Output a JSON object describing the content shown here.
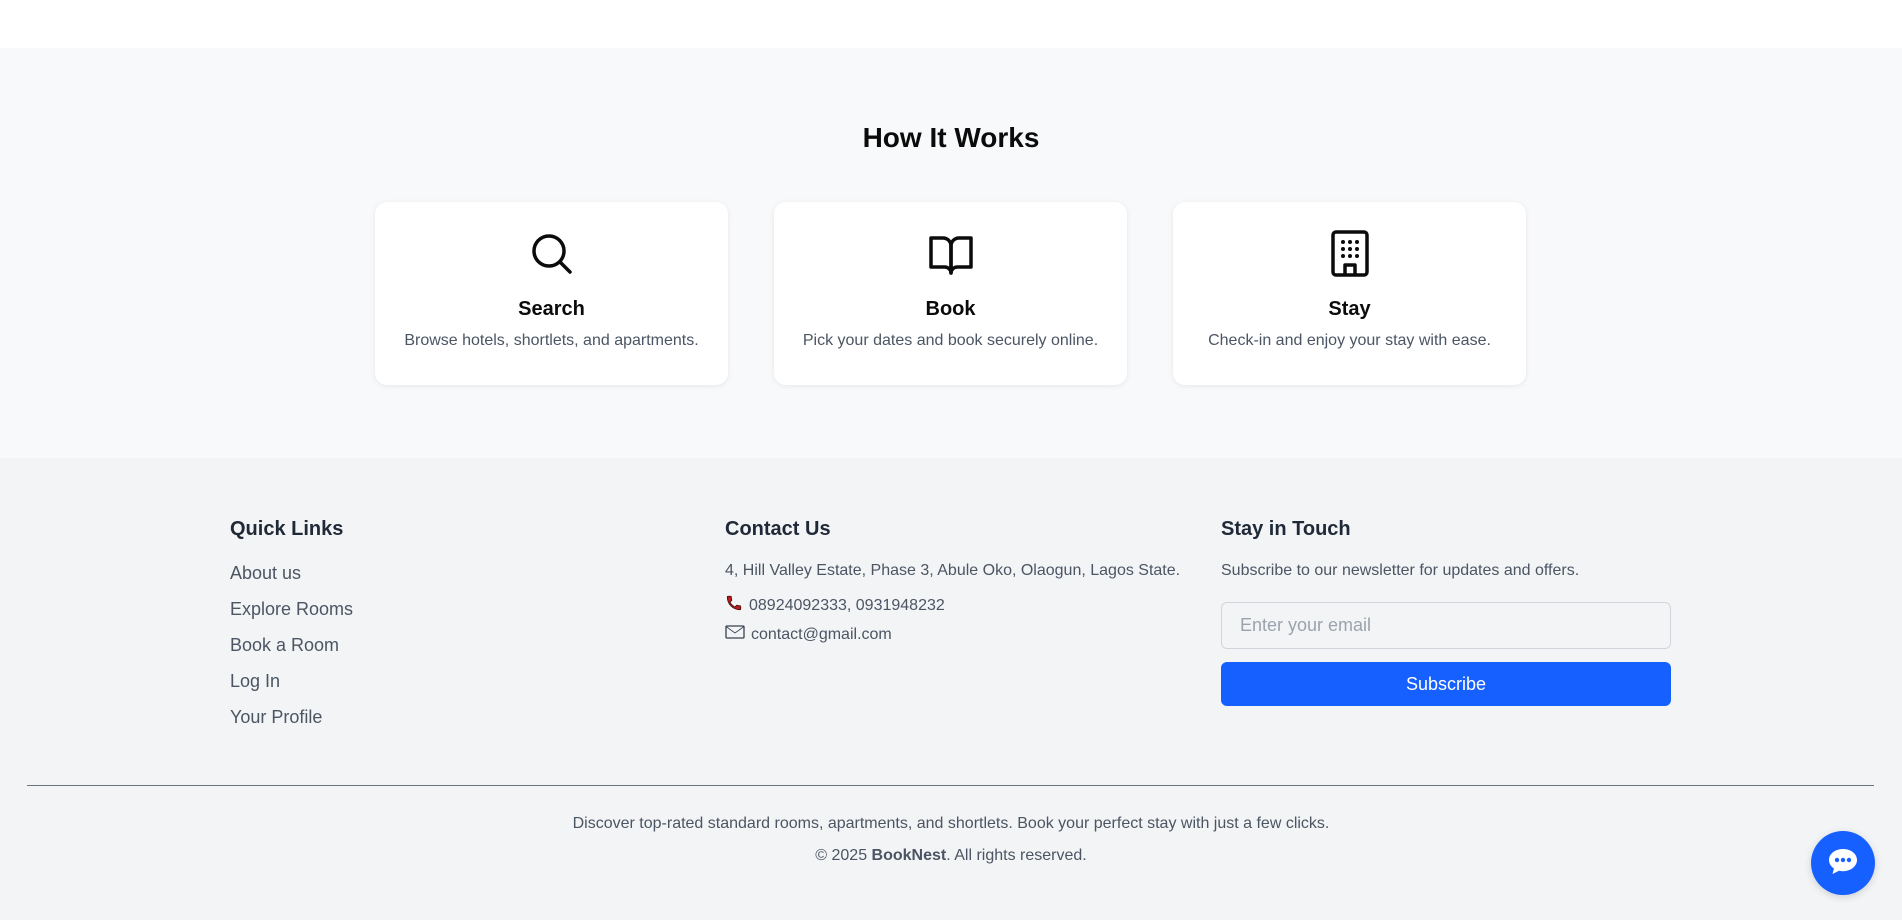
{
  "how_it_works": {
    "title": "How It Works",
    "cards": [
      {
        "icon": "search-icon",
        "title": "Search",
        "description": "Browse hotels, shortlets, and apartments."
      },
      {
        "icon": "book-open-icon",
        "title": "Book",
        "description": "Pick your dates and book securely online."
      },
      {
        "icon": "building-icon",
        "title": "Stay",
        "description": "Check-in and enjoy your stay with ease."
      }
    ]
  },
  "footer": {
    "quick_links": {
      "title": "Quick Links",
      "items": [
        "About us",
        "Explore Rooms",
        "Book a Room",
        "Log In",
        "Your Profile"
      ]
    },
    "contact": {
      "title": "Contact Us",
      "address": "4, Hill Valley Estate, Phase 3, Abule Oko, Olaogun, Lagos State.",
      "phone": "08924092333, 0931948232",
      "email": "contact@gmail.com"
    },
    "newsletter": {
      "title": "Stay in Touch",
      "description": "Subscribe to our newsletter for updates and offers.",
      "email_placeholder": "Enter your email",
      "subscribe_label": "Subscribe"
    },
    "tagline": "Discover top-rated standard rooms, apartments, and shortlets. Book your perfect stay with just a few clicks.",
    "copyright_prefix": "© 2025",
    "brand": "BookNest",
    "copyright_suffix": ". All rights reserved."
  },
  "colors": {
    "accent": "#1660ff",
    "section_bg": "#f8f9fb",
    "footer_bg": "#f3f4f6",
    "phone_icon": "#b91c1c"
  },
  "chat": {
    "icon": "chat-bubble-icon"
  }
}
